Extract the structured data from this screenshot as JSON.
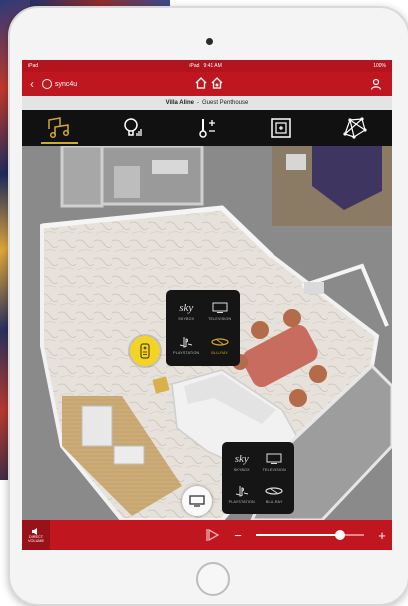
{
  "statusbar": {
    "left": "iPad",
    "center_left": "iPad",
    "time": "9:41 AM",
    "right": "100%"
  },
  "app": {
    "logo_text": "sync4u",
    "back_icon": "back-arrow-icon",
    "user_icon": "user-icon"
  },
  "location": {
    "villa": "Villa Aline",
    "separator": "-",
    "room": "Guest Penthouse"
  },
  "categories": [
    {
      "name": "media",
      "icon": "music-icon",
      "active": true
    },
    {
      "name": "lights",
      "icon": "bulb-icon",
      "active": false
    },
    {
      "name": "climate",
      "icon": "thermometer-icon",
      "active": false
    },
    {
      "name": "scenes",
      "icon": "scene-icon",
      "active": false
    },
    {
      "name": "security",
      "icon": "network-icon",
      "active": false
    }
  ],
  "popup_top": {
    "sources": [
      {
        "label": "SKYBOX",
        "icon": "sky-logo",
        "selected": false
      },
      {
        "label": "TELEVISION",
        "icon": "tv-icon",
        "selected": false
      },
      {
        "label": "PLAYSTATION",
        "icon": "playstation-icon",
        "selected": false
      },
      {
        "label": "BLU-RAY",
        "icon": "bluray-icon",
        "selected": true
      }
    ]
  },
  "popup_bottom": {
    "sources": [
      {
        "label": "SKYBOX",
        "icon": "sky-logo",
        "selected": false
      },
      {
        "label": "TELEVISION",
        "icon": "tv-icon",
        "selected": false
      },
      {
        "label": "PLAYSTATION",
        "icon": "playstation-icon",
        "selected": false
      },
      {
        "label": "BLU-RAY",
        "icon": "bluray-icon",
        "selected": false
      }
    ]
  },
  "bottombar": {
    "direct_line1": "DIRECT",
    "direct_line2": "VOLUME",
    "minus": "−",
    "plus": "+"
  },
  "volume": {
    "level": 0.78
  },
  "colors": {
    "brand_red": "#c0161f",
    "accent_gold": "#d4a82a",
    "dark": "#151515"
  }
}
